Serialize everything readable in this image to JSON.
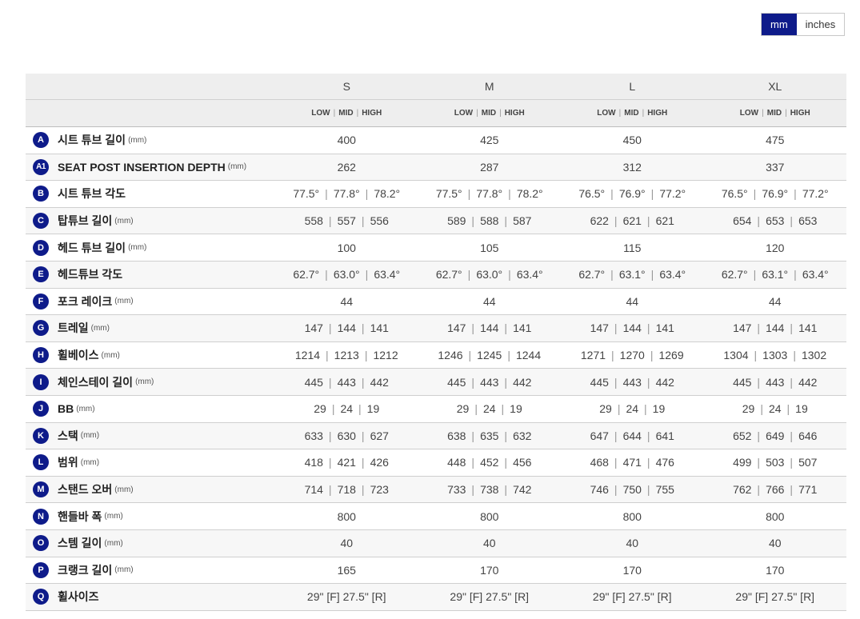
{
  "units": {
    "active": "mm",
    "inactive": "inches"
  },
  "sizes": [
    "S",
    "M",
    "L",
    "XL"
  ],
  "settings": [
    "LOW",
    "MID",
    "HIGH"
  ],
  "rows": [
    {
      "code": "A",
      "name": "시트 튜브 길이",
      "unit": "(mm)",
      "values": [
        [
          "400"
        ],
        [
          "425"
        ],
        [
          "450"
        ],
        [
          "475"
        ]
      ]
    },
    {
      "code": "A1",
      "name": "SEAT POST INSERTION DEPTH",
      "unit": "(mm)",
      "values": [
        [
          "262"
        ],
        [
          "287"
        ],
        [
          "312"
        ],
        [
          "337"
        ]
      ]
    },
    {
      "code": "B",
      "name": "시트 튜브 각도",
      "unit": "",
      "values": [
        [
          "77.5°",
          "77.8°",
          "78.2°"
        ],
        [
          "77.5°",
          "77.8°",
          "78.2°"
        ],
        [
          "76.5°",
          "76.9°",
          "77.2°"
        ],
        [
          "76.5°",
          "76.9°",
          "77.2°"
        ]
      ]
    },
    {
      "code": "C",
      "name": "탑튜브 길이",
      "unit": "(mm)",
      "values": [
        [
          "558",
          "557",
          "556"
        ],
        [
          "589",
          "588",
          "587"
        ],
        [
          "622",
          "621",
          "621"
        ],
        [
          "654",
          "653",
          "653"
        ]
      ]
    },
    {
      "code": "D",
      "name": "헤드 튜브 길이",
      "unit": "(mm)",
      "values": [
        [
          "100"
        ],
        [
          "105"
        ],
        [
          "115"
        ],
        [
          "120"
        ]
      ]
    },
    {
      "code": "E",
      "name": "헤드튜브 각도",
      "unit": "",
      "values": [
        [
          "62.7°",
          "63.0°",
          "63.4°"
        ],
        [
          "62.7°",
          "63.0°",
          "63.4°"
        ],
        [
          "62.7°",
          "63.1°",
          "63.4°"
        ],
        [
          "62.7°",
          "63.1°",
          "63.4°"
        ]
      ]
    },
    {
      "code": "F",
      "name": "포크 레이크",
      "unit": "(mm)",
      "values": [
        [
          "44"
        ],
        [
          "44"
        ],
        [
          "44"
        ],
        [
          "44"
        ]
      ]
    },
    {
      "code": "G",
      "name": "트레일",
      "unit": "(mm)",
      "values": [
        [
          "147",
          "144",
          "141"
        ],
        [
          "147",
          "144",
          "141"
        ],
        [
          "147",
          "144",
          "141"
        ],
        [
          "147",
          "144",
          "141"
        ]
      ]
    },
    {
      "code": "H",
      "name": "휠베이스",
      "unit": "(mm)",
      "values": [
        [
          "1214",
          "1213",
          "1212"
        ],
        [
          "1246",
          "1245",
          "1244"
        ],
        [
          "1271",
          "1270",
          "1269"
        ],
        [
          "1304",
          "1303",
          "1302"
        ]
      ]
    },
    {
      "code": "I",
      "name": "체인스테이 길이",
      "unit": "(mm)",
      "values": [
        [
          "445",
          "443",
          "442"
        ],
        [
          "445",
          "443",
          "442"
        ],
        [
          "445",
          "443",
          "442"
        ],
        [
          "445",
          "443",
          "442"
        ]
      ]
    },
    {
      "code": "J",
      "name": "BB",
      "unit": "(mm)",
      "values": [
        [
          "29",
          "24",
          "19"
        ],
        [
          "29",
          "24",
          "19"
        ],
        [
          "29",
          "24",
          "19"
        ],
        [
          "29",
          "24",
          "19"
        ]
      ]
    },
    {
      "code": "K",
      "name": "스택",
      "unit": "(mm)",
      "values": [
        [
          "633",
          "630",
          "627"
        ],
        [
          "638",
          "635",
          "632"
        ],
        [
          "647",
          "644",
          "641"
        ],
        [
          "652",
          "649",
          "646"
        ]
      ]
    },
    {
      "code": "L",
      "name": "범위",
      "unit": "(mm)",
      "values": [
        [
          "418",
          "421",
          "426"
        ],
        [
          "448",
          "452",
          "456"
        ],
        [
          "468",
          "471",
          "476"
        ],
        [
          "499",
          "503",
          "507"
        ]
      ]
    },
    {
      "code": "M",
      "name": "스탠드 오버",
      "unit": "(mm)",
      "values": [
        [
          "714",
          "718",
          "723"
        ],
        [
          "733",
          "738",
          "742"
        ],
        [
          "746",
          "750",
          "755"
        ],
        [
          "762",
          "766",
          "771"
        ]
      ]
    },
    {
      "code": "N",
      "name": "핸들바 폭",
      "unit": "(mm)",
      "values": [
        [
          "800"
        ],
        [
          "800"
        ],
        [
          "800"
        ],
        [
          "800"
        ]
      ]
    },
    {
      "code": "O",
      "name": "스템 길이",
      "unit": "(mm)",
      "values": [
        [
          "40"
        ],
        [
          "40"
        ],
        [
          "40"
        ],
        [
          "40"
        ]
      ]
    },
    {
      "code": "P",
      "name": "크랭크 길이",
      "unit": "(mm)",
      "values": [
        [
          "165"
        ],
        [
          "170"
        ],
        [
          "170"
        ],
        [
          "170"
        ]
      ]
    },
    {
      "code": "Q",
      "name": "휠사이즈",
      "unit": "",
      "values": [
        [
          "29\" [F] 27.5\" [R]"
        ],
        [
          "29\" [F] 27.5\" [R]"
        ],
        [
          "29\" [F] 27.5\" [R]"
        ],
        [
          "29\" [F] 27.5\" [R]"
        ]
      ]
    }
  ],
  "colors": {
    "accent": "#0e1b8a",
    "header_bg": "#eeeeee",
    "row_alt": "#f7f7f7"
  }
}
